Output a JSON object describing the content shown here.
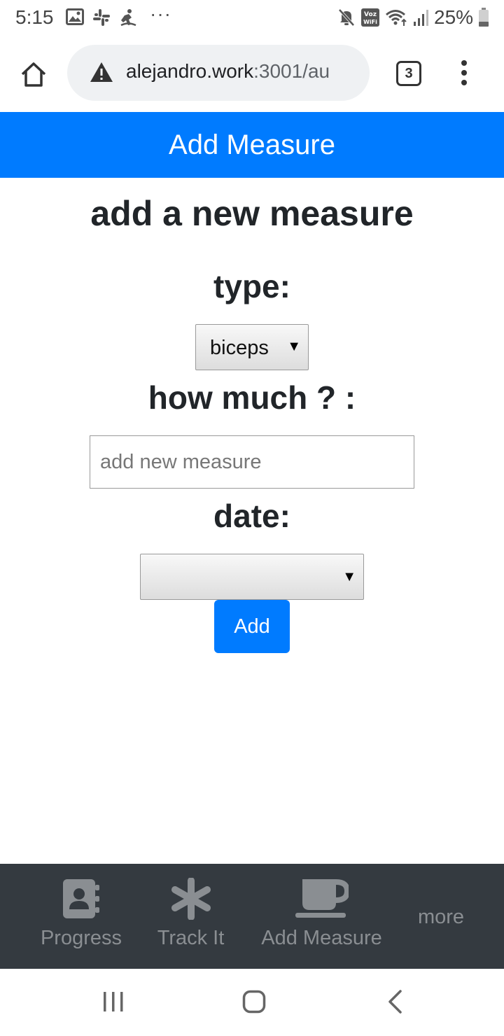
{
  "status_bar": {
    "time": "5:15",
    "battery": "25%",
    "icons": [
      "gallery-icon",
      "slack-icon",
      "fitness-icon",
      "more-notifications-icon",
      "mute-icon",
      "vowifi-icon",
      "wifi-icon",
      "signal-icon",
      "battery-icon"
    ],
    "vowifi_label_top": "Voz",
    "vowifi_label_bottom": "WiFi"
  },
  "browser": {
    "url_host": "alejandro.work",
    "url_path": ":3001/au",
    "tab_count": "3"
  },
  "header": {
    "title": "Add Measure",
    "color": "#007bff"
  },
  "form": {
    "title": "add a new measure",
    "type_label": "type:",
    "type_selected": "biceps",
    "amount_label": "how much ? :",
    "amount_value": "",
    "amount_placeholder": "add new measure",
    "date_label": "date:",
    "date_selected": "",
    "submit_label": "Add"
  },
  "bottom_nav": {
    "background": "#343a40",
    "items": [
      {
        "label": "Progress",
        "icon": "contact-book-icon"
      },
      {
        "label": "Track It",
        "icon": "asterisk-icon"
      },
      {
        "label": "Add Measure",
        "icon": "coffee-cup-icon"
      },
      {
        "label": "more",
        "icon": ""
      }
    ]
  },
  "android_nav": {
    "buttons": [
      "recents-icon",
      "home-icon",
      "back-icon"
    ]
  }
}
